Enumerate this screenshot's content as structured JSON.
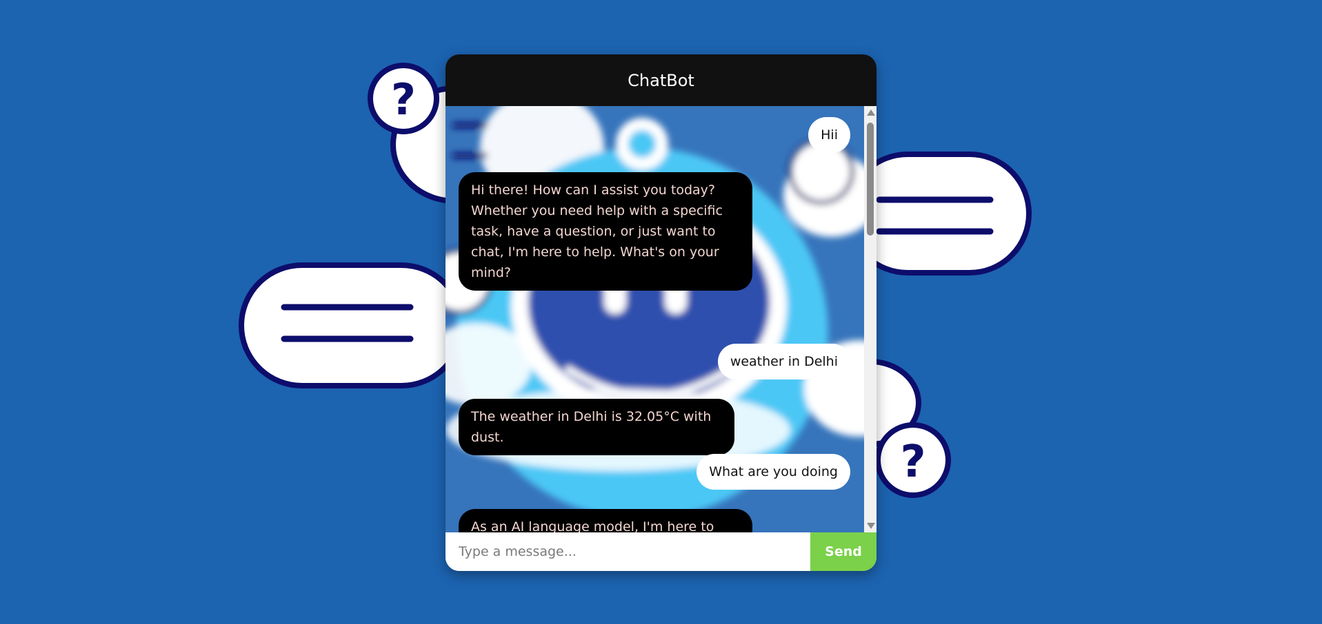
{
  "header": {
    "title": "ChatBot"
  },
  "messages": [
    {
      "role": "user",
      "text": "Hii"
    },
    {
      "role": "bot",
      "text": "Hi there! How can I assist you today? Whether you need help with a specific task, have a question, or just want to chat, I'm here to help. What's on your mind?"
    },
    {
      "role": "user",
      "text": "weather in Delhi"
    },
    {
      "role": "bot",
      "text": "The weather in Delhi is 32.05°C with dust."
    },
    {
      "role": "user",
      "text": "What are you doing"
    },
    {
      "role": "bot",
      "text": "As an AI language model, I'm here to assist you with a wide range of tasks and provide thorough, informative responses to your questions. I can help with explanations, ideas,"
    }
  ],
  "input": {
    "placeholder": "Type a message...",
    "value": ""
  },
  "send": {
    "label": "Send"
  },
  "colors": {
    "page_background": "#1c63b0",
    "header_background": "#111111",
    "bot_bubble": "#000000",
    "bot_text": "#f3d6d0",
    "user_bubble": "#ffffff",
    "send_button": "#7bd14a"
  }
}
